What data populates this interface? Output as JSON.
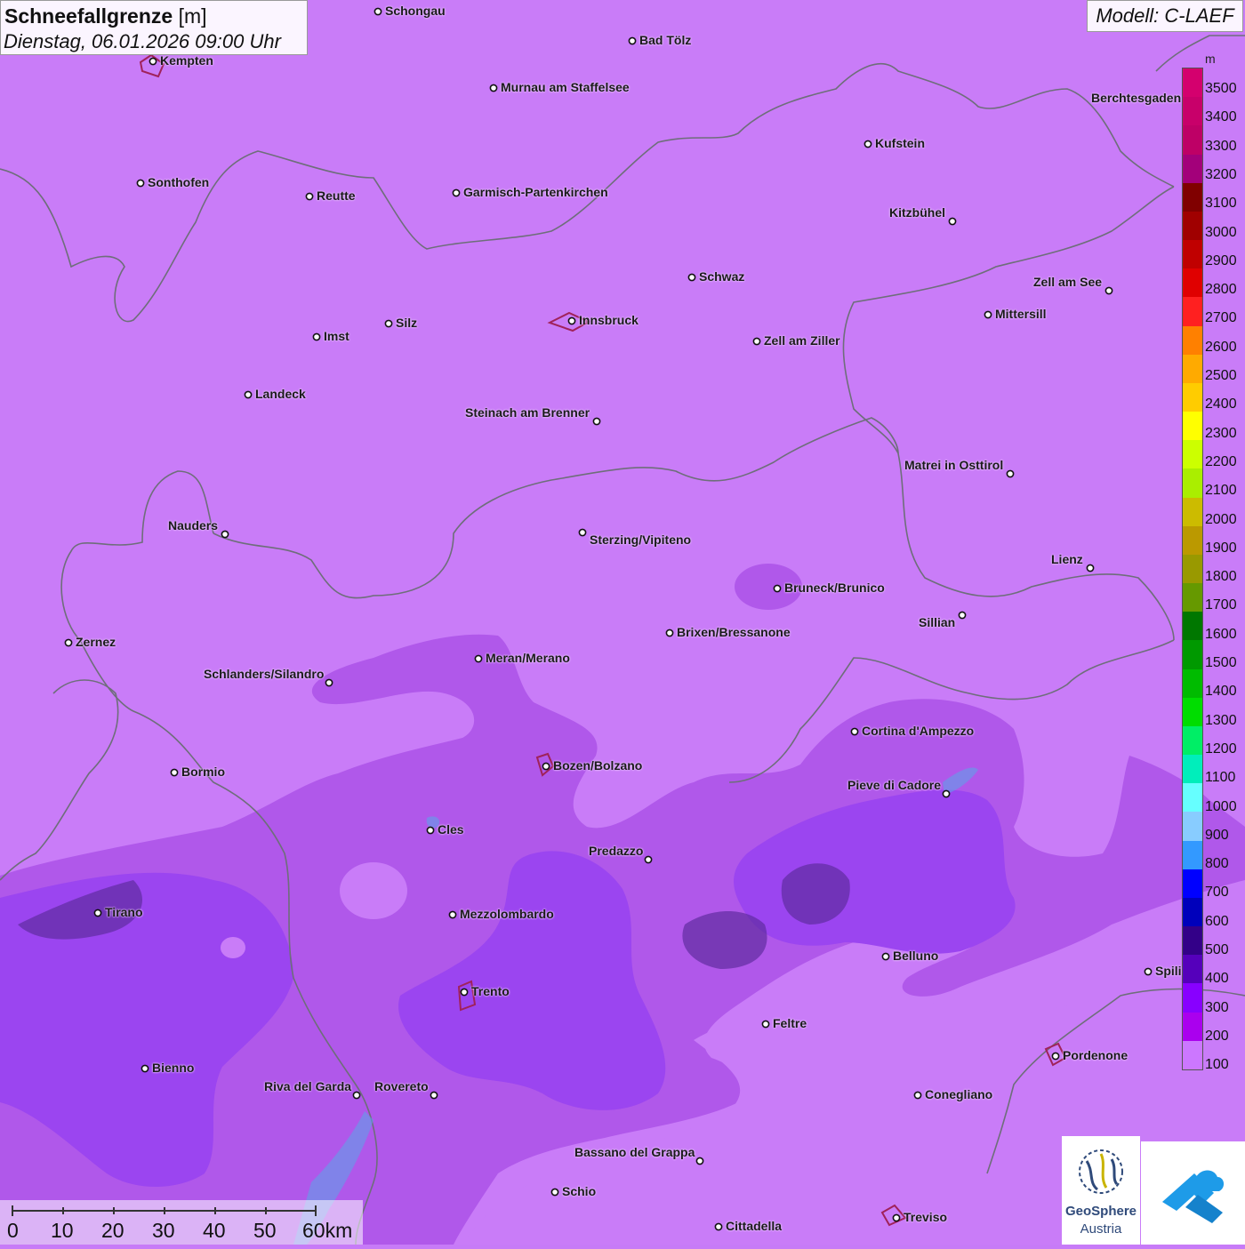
{
  "header": {
    "title_bold": "Schneefallgrenze",
    "title_unit": "[m]",
    "datetime": "Dienstag, 06.01.2026 09:00 Uhr",
    "model": "Modell: C-LAEF"
  },
  "legend": {
    "unit": "m",
    "ticks": [
      "3500",
      "3400",
      "3300",
      "3200",
      "3100",
      "3000",
      "2900",
      "2800",
      "2700",
      "2600",
      "2500",
      "2400",
      "2300",
      "2200",
      "2100",
      "2000",
      "1900",
      "1800",
      "1700",
      "1600",
      "1500",
      "1400",
      "1300",
      "1200",
      "1100",
      "1000",
      "900",
      "800",
      "700",
      "600",
      "500",
      "400",
      "300",
      "200",
      "100"
    ],
    "colors": [
      "#d4006e",
      "#c8006a",
      "#be0066",
      "#a3007a",
      "#800000",
      "#a00000",
      "#c00000",
      "#e00000",
      "#ff2020",
      "#ff8000",
      "#ffaa00",
      "#ffcc00",
      "#ffff00",
      "#ccff00",
      "#aaee00",
      "#ccbb00",
      "#bb9900",
      "#999900",
      "#669900",
      "#007700",
      "#009900",
      "#00bb00",
      "#00dd00",
      "#00ee66",
      "#00eebb",
      "#66ffff",
      "#88ccff",
      "#3399ff",
      "#0000ff",
      "#0000bb",
      "#330088",
      "#5500bb",
      "#8800ff",
      "#aa00ee",
      "#cc77ff"
    ]
  },
  "cities": [
    {
      "name": "Schongau"
    },
    {
      "name": "Bad Tölz"
    },
    {
      "name": "Kempten"
    },
    {
      "name": "Murnau am Staffelsee"
    },
    {
      "name": "Berchtesgaden"
    },
    {
      "name": "Kufstein"
    },
    {
      "name": "Sonthofen"
    },
    {
      "name": "Reutte"
    },
    {
      "name": "Garmisch-Partenkirchen"
    },
    {
      "name": "Kitzbühel"
    },
    {
      "name": "Schwaz"
    },
    {
      "name": "Zell am See"
    },
    {
      "name": "Mittersill"
    },
    {
      "name": "Innsbruck"
    },
    {
      "name": "Silz"
    },
    {
      "name": "Imst"
    },
    {
      "name": "Zell am Ziller"
    },
    {
      "name": "Landeck"
    },
    {
      "name": "Steinach am Brenner"
    },
    {
      "name": "Matrei in Osttirol"
    },
    {
      "name": "Nauders"
    },
    {
      "name": "Sterzing/Vipiteno"
    },
    {
      "name": "Lienz"
    },
    {
      "name": "Bruneck/Brunico"
    },
    {
      "name": "Sillian"
    },
    {
      "name": "Zernez"
    },
    {
      "name": "Brixen/Bressanone"
    },
    {
      "name": "Meran/Merano"
    },
    {
      "name": "Schlanders/Silandro"
    },
    {
      "name": "Cortina d'Ampezzo"
    },
    {
      "name": "Bozen/Bolzano"
    },
    {
      "name": "Bormio"
    },
    {
      "name": "Pieve di Cadore"
    },
    {
      "name": "Cles"
    },
    {
      "name": "Predazzo"
    },
    {
      "name": "Tirano"
    },
    {
      "name": "Mezzolombardo"
    },
    {
      "name": "Belluno"
    },
    {
      "name": "Spili"
    },
    {
      "name": "Trento"
    },
    {
      "name": "Feltre"
    },
    {
      "name": "Pordenone"
    },
    {
      "name": "Bienno"
    },
    {
      "name": "Riva del Garda"
    },
    {
      "name": "Rovereto"
    },
    {
      "name": "Conegliano"
    },
    {
      "name": "Bassano del Grappa"
    },
    {
      "name": "Schio"
    },
    {
      "name": "Treviso"
    },
    {
      "name": "Cittadella"
    }
  ],
  "scale": {
    "labels": [
      "0",
      "10",
      "20",
      "30",
      "40",
      "50",
      "60km"
    ]
  },
  "logo": {
    "line1": "GeoSphere",
    "line2": "Austria"
  }
}
